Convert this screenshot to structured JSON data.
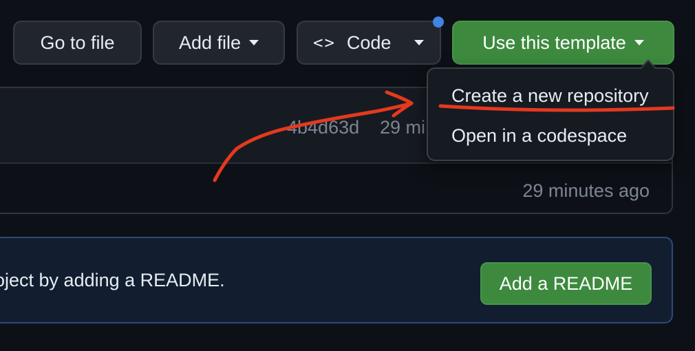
{
  "toolbar": {
    "go_to_file": "Go to file",
    "add_file": "Add file",
    "code": "Code",
    "use_template": "Use this template"
  },
  "icons": {
    "caret": "triangle-down-icon",
    "code": "code-brackets-icon",
    "notification": "notification-dot-icon"
  },
  "template_menu": {
    "items": [
      {
        "label": "Create a new repository"
      },
      {
        "label": "Open in a codespace"
      }
    ]
  },
  "files": {
    "latest_commit_hash": "4b4d63d",
    "latest_commit_time_partial": "29 mi",
    "row_time": "29 minutes ago"
  },
  "readme_banner": {
    "text": "oject by adding a README.",
    "button": "Add a README"
  },
  "colors": {
    "background": "#0d1117",
    "primary_button": "#3d8a3f",
    "annotation_stroke": "#e5391e",
    "notification_dot": "#4184e4",
    "readme_border": "#2a4a7e"
  }
}
